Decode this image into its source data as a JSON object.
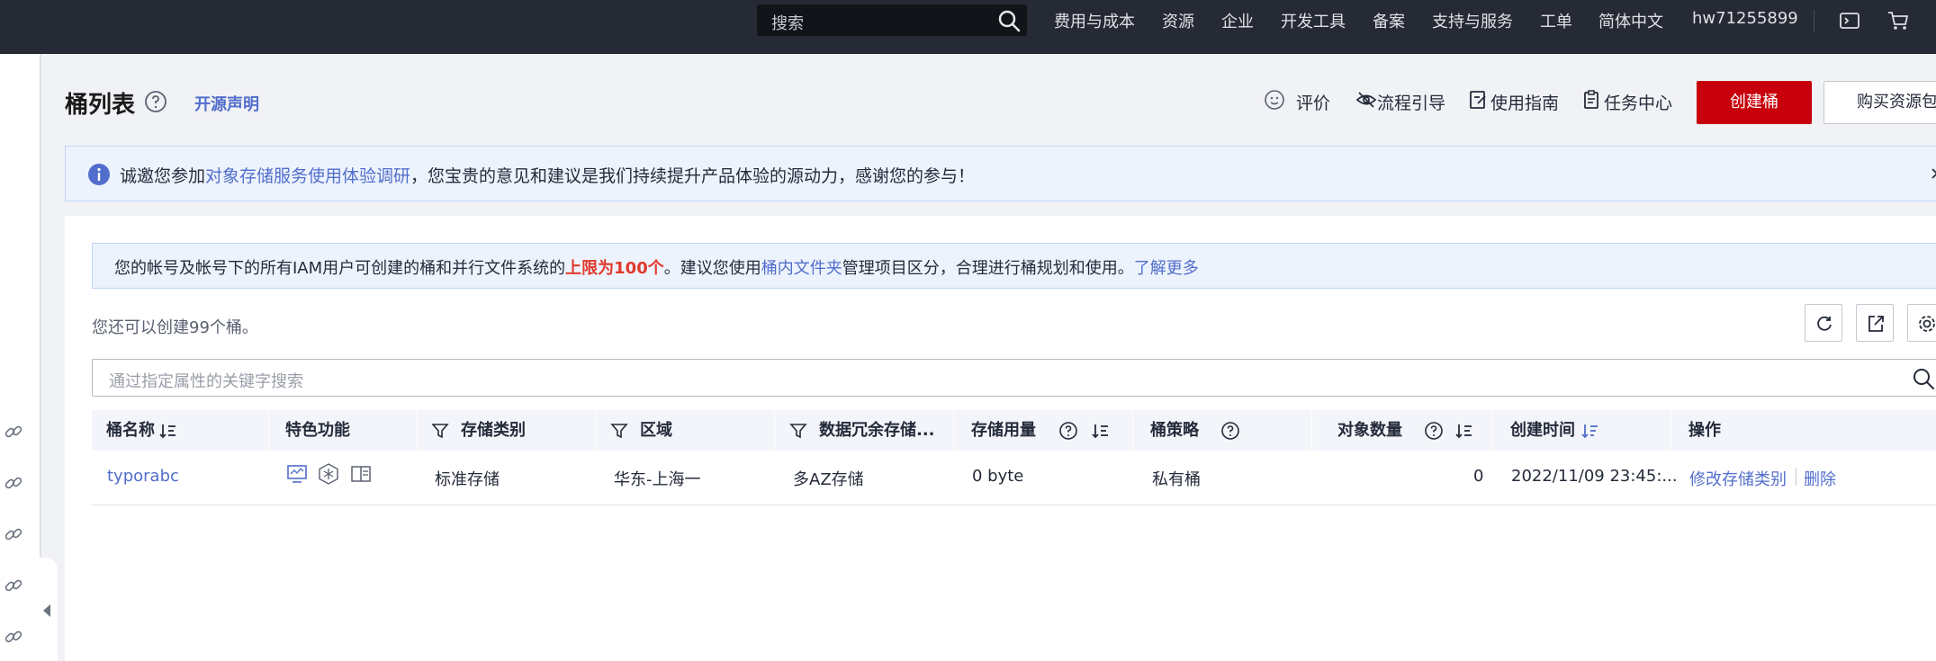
{
  "topbar": {
    "search_placeholder": "搜索",
    "nav": [
      "费用与成本",
      "资源",
      "企业",
      "开发工具",
      "备案",
      "支持与服务",
      "工单",
      "简体中文"
    ],
    "username": "hw71255899"
  },
  "header": {
    "title": "桶列表",
    "open_source": "开源声明",
    "links": [
      "评价",
      "流程引导",
      "使用指南",
      "任务中心"
    ],
    "create_button": "创建桶",
    "buy_button": "购买资源包"
  },
  "survey": {
    "prefix": "诚邀您参加",
    "link": "对象存储服务使用体验调研",
    "suffix": "，您宝贵的意见和建议是我们持续提升产品体验的源动力，感谢您的参与！"
  },
  "limit_notice": {
    "prefix": "您的帐号及帐号下的所有IAM用户可创建的桶和并行文件系统的",
    "highlight": "上限为100个",
    "middle": "。建议您使用",
    "link1": "桶内文件夹",
    "middle2": "管理项目区分，合理进行桶规划和使用。",
    "link2": "了解更多"
  },
  "remaining": "您还可以创建99个桶。",
  "filter_placeholder": "通过指定属性的关键字搜索",
  "table": {
    "columns": [
      "桶名称",
      "特色功能",
      "存储类别",
      "区域",
      "数据冗余存储...",
      "存储用量",
      "桶策略",
      "对象数量",
      "创建时间",
      "操作"
    ],
    "rows": [
      {
        "name": "typorabc",
        "features": [
          "monitor-icon",
          "snowflake-icon",
          "split-view-icon"
        ],
        "storage_class": "标准存储",
        "region": "华东-上海一",
        "redundancy": "多AZ存储",
        "usage": "0 byte",
        "policy": "私有桶",
        "objects": "0",
        "created": "2022/11/09 23:45:...",
        "actions": [
          "修改存储类别",
          "删除"
        ]
      }
    ]
  }
}
